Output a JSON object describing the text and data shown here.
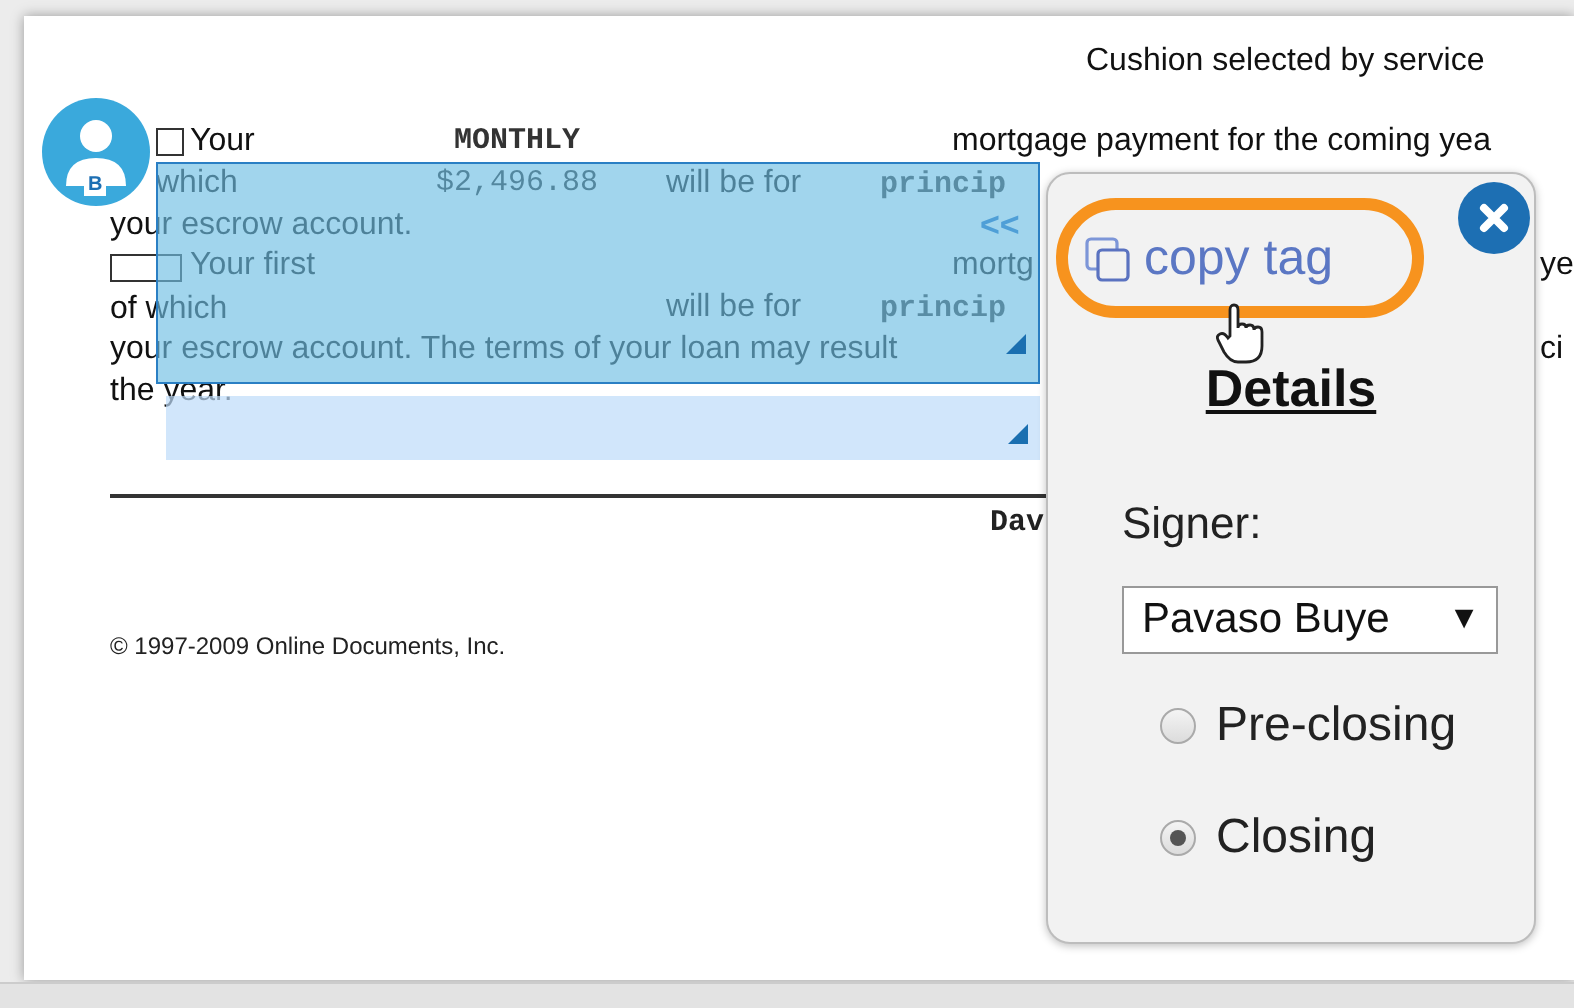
{
  "avatar": {
    "initial": "B"
  },
  "document": {
    "header": "Cushion selected by service",
    "lines": [
      {
        "checkbox": {
          "checked": false
        },
        "lead": "Your",
        "amount": {
          "text": "MONTHLY",
          "kind": "mono-bold"
        },
        "tail": {
          "text": "mortgage payment for the coming yea",
          "kind": "plain"
        }
      },
      {
        "lead": "which",
        "amount": {
          "text": "$2,496.88",
          "kind": "mono"
        },
        "mid": "will be for",
        "tail": {
          "text": "princip",
          "kind": "mono-bold"
        }
      },
      {
        "lead": "your escrow account.",
        "tail": {
          "text": "<<",
          "kind": "marker"
        }
      },
      {
        "checkbox": {
          "checked": false
        },
        "lead": "Your first",
        "tail": {
          "text": "mortg",
          "kind": "plain"
        },
        "edge": "ye"
      },
      {
        "lead": "of which",
        "mid": "will be for",
        "tail": {
          "text": "princip",
          "kind": "mono-bold"
        }
      },
      {
        "lead": "your escrow account. The terms of your loan may result",
        "edge": "ci"
      },
      {
        "lead": "the year."
      }
    ],
    "signature_label": "Dav",
    "footer": "© 1997-2009 Online Documents, Inc."
  },
  "popup": {
    "copy_label": "copy tag",
    "title": "Details",
    "signer_label": "Signer:",
    "signer_value": "Pavaso Buye",
    "dropdown_arrow": "▼",
    "options": [
      {
        "label": "Pre-closing",
        "selected": false
      },
      {
        "label": "Closing",
        "selected": true
      }
    ]
  }
}
